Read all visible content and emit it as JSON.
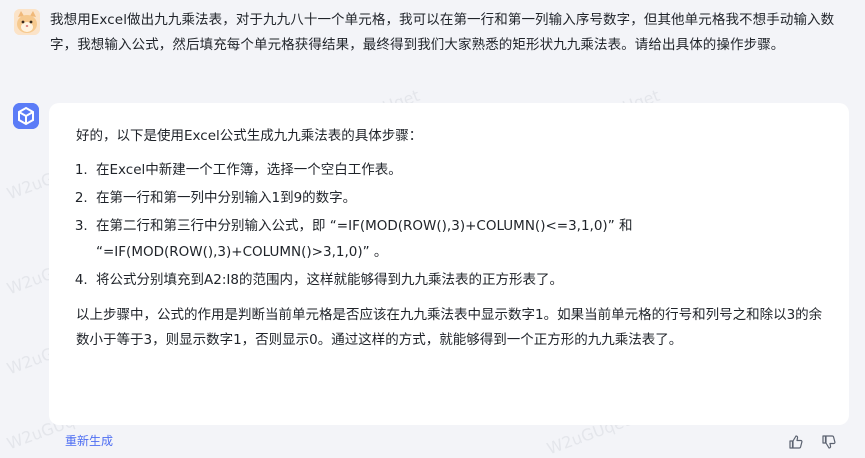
{
  "user_message": "我想用Excel做出九九乘法表，对于九九八十一个单元格，我可以在第一行和第一列输入序号数字，但其他单元格我不想手动输入数字，我想输入公式，然后填充每个单元格获得结果，最终得到我们大家熟悉的矩形状九九乘法表。请给出具体的操作步骤。",
  "assistant": {
    "intro": "好的，以下是使用Excel公式生成九九乘法表的具体步骤：",
    "steps": [
      "在Excel中新建一个工作簿，选择一个空白工作表。",
      "在第一行和第一列中分别输入1到9的数字。",
      "在第二行和第三行中分别输入公式，即 “=IF(MOD(ROW(),3)+COLUMN()<=3,1,0)” 和 “=IF(MOD(ROW(),3)+COLUMN()>3,1,0)” 。",
      "将公式分别填充到A2:I8的范围内，这样就能够得到九九乘法表的正方形表了。"
    ],
    "outro": "以上步骤中，公式的作用是判断当前单元格是否应该在九九乘法表中显示数字1。如果当前单元格的行号和列号之和除以3的余数小于等于3，则显示数字1，否则显示0。通过这样的方式，就能够得到一个正方形的九九乘法表了。"
  },
  "actions": {
    "regenerate": "重新生成",
    "thumbs_up_icon": "thumbs-up-icon",
    "thumbs_down_icon": "thumbs-down-icon"
  },
  "watermark": "W2uGUqet",
  "colors": {
    "accent": "#4e6ef2",
    "card": "#ffffff",
    "background": "#f3f4f8"
  }
}
